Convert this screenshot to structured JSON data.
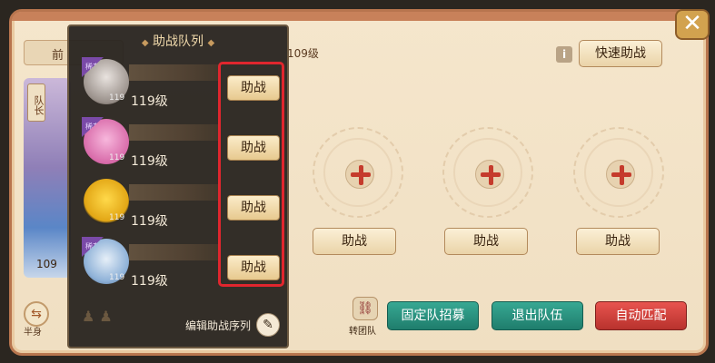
{
  "window": {
    "top_tab_label": "前",
    "header_level": "109级",
    "quick_assist_label": "快速助战",
    "info_symbol": "i",
    "close_symbol": "✕"
  },
  "leader": {
    "tag_label": "队长",
    "level": "109",
    "half_symbol": "⇆",
    "half_label": "半身"
  },
  "assist_list": {
    "title": "助战队列",
    "title_ornament": "◆",
    "edit_label": "编辑助战序列",
    "brush_symbol": "✎",
    "members": [
      {
        "level": "119级",
        "avatar_level": "119",
        "rank": "稀有",
        "button_label": "助战",
        "avatar_color": "#cfc6c0"
      },
      {
        "level": "119级",
        "avatar_level": "119",
        "rank": "稀有",
        "button_label": "助战",
        "avatar_color": "#e48fc3"
      },
      {
        "level": "119级",
        "avatar_level": "119",
        "rank": "",
        "button_label": "助战",
        "avatar_color": "#f2c22d"
      },
      {
        "level": "119级",
        "avatar_level": "119",
        "rank": "稀有",
        "button_label": "助战",
        "avatar_color": "#a7c6e6"
      }
    ]
  },
  "slots": [
    {
      "button_label": "助战"
    },
    {
      "button_label": "助战"
    },
    {
      "button_label": "助战"
    }
  ],
  "bottom": {
    "transfer_symbol": "⛓",
    "transfer_label": "转团队",
    "recruit_label": "固定队招募",
    "leave_label": "退出队伍",
    "auto_match_label": "自动匹配"
  }
}
